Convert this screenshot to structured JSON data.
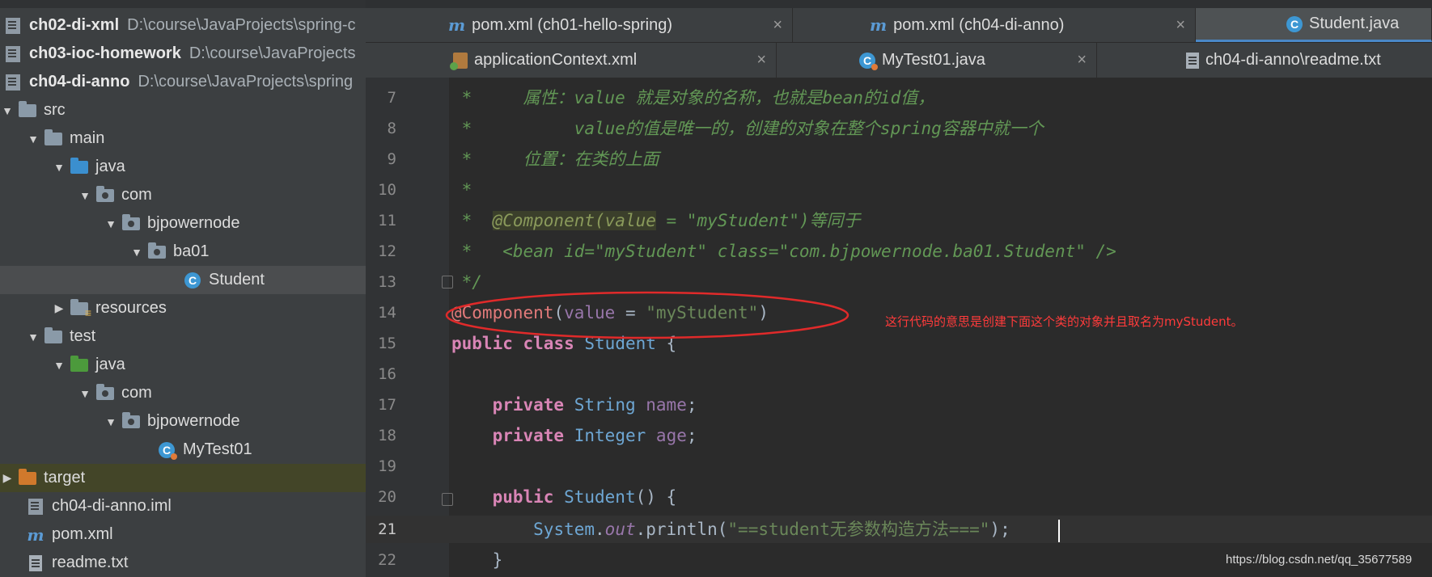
{
  "project_tree": {
    "items": [
      {
        "name": "ch02-di-xml",
        "path": "D:\\course\\JavaProjects\\spring-c"
      },
      {
        "name": "ch03-ioc-homework",
        "path": "D:\\course\\JavaProjects"
      },
      {
        "name": "ch04-di-anno",
        "path": "D:\\course\\JavaProjects\\spring"
      },
      {
        "name": "src"
      },
      {
        "name": "main"
      },
      {
        "name": "java"
      },
      {
        "name": "com"
      },
      {
        "name": "bjpowernode"
      },
      {
        "name": "ba01"
      },
      {
        "name": "Student"
      },
      {
        "name": "resources"
      },
      {
        "name": "test"
      },
      {
        "name": "java"
      },
      {
        "name": "com"
      },
      {
        "name": "bjpowernode"
      },
      {
        "name": "MyTest01"
      },
      {
        "name": "target"
      },
      {
        "name": "ch04-di-anno.iml"
      },
      {
        "name": "pom.xml"
      },
      {
        "name": "readme.txt"
      }
    ]
  },
  "tabs_row1": [
    {
      "label": "pom.xml (ch01-hello-spring)",
      "icon": "maven-icon",
      "close": "×"
    },
    {
      "label": "pom.xml (ch04-di-anno)",
      "icon": "maven-icon",
      "close": "×"
    },
    {
      "label": "Student.java",
      "icon": "class-icon",
      "active": true
    }
  ],
  "tabs_row2": [
    {
      "label": "applicationContext.xml",
      "icon": "xml-icon",
      "close": "×"
    },
    {
      "label": "MyTest01.java",
      "icon": "test-class-icon",
      "close": "×"
    },
    {
      "label": "ch04-di-anno\\readme.txt",
      "icon": "text-file-icon"
    }
  ],
  "editor": {
    "lines": [
      {
        "n": "7",
        "text": " *     属性：value 就是对象的名称，也就是bean的id值，"
      },
      {
        "n": "8",
        "text": " *          value的值是唯一的，创建的对象在整个spring容器中就一个"
      },
      {
        "n": "9",
        "text": " *     位置：在类的上面"
      },
      {
        "n": "10",
        "text": " *"
      },
      {
        "n": "11",
        "text": " *  @Component(value = \"myStudent\")等同于"
      },
      {
        "n": "12",
        "text": " *   <bean id=\"myStudent\" class=\"com.bjpowernode.ba01.Student\" />"
      },
      {
        "n": "13",
        "text": " */"
      },
      {
        "n": "14",
        "text": "@Component(value = \"myStudent\")"
      },
      {
        "n": "15",
        "text": "public class Student {"
      },
      {
        "n": "16",
        "text": ""
      },
      {
        "n": "17",
        "text": "    private String name;"
      },
      {
        "n": "18",
        "text": "    private Integer age;"
      },
      {
        "n": "19",
        "text": ""
      },
      {
        "n": "20",
        "text": "    public Student() {"
      },
      {
        "n": "21",
        "text": "        System.out.println(\"==student无参数构造方法===\");"
      },
      {
        "n": "22",
        "text": "    }"
      }
    ],
    "current_line": "21"
  },
  "annotation_note": "这行代码的意思是创建下面这个类的对象并且取名为myStudent。",
  "watermark": "https://blog.csdn.net/qq_35677589",
  "colors": {
    "annotation_red": "#ff3b3b",
    "accent_blue": "#4a88c7"
  }
}
